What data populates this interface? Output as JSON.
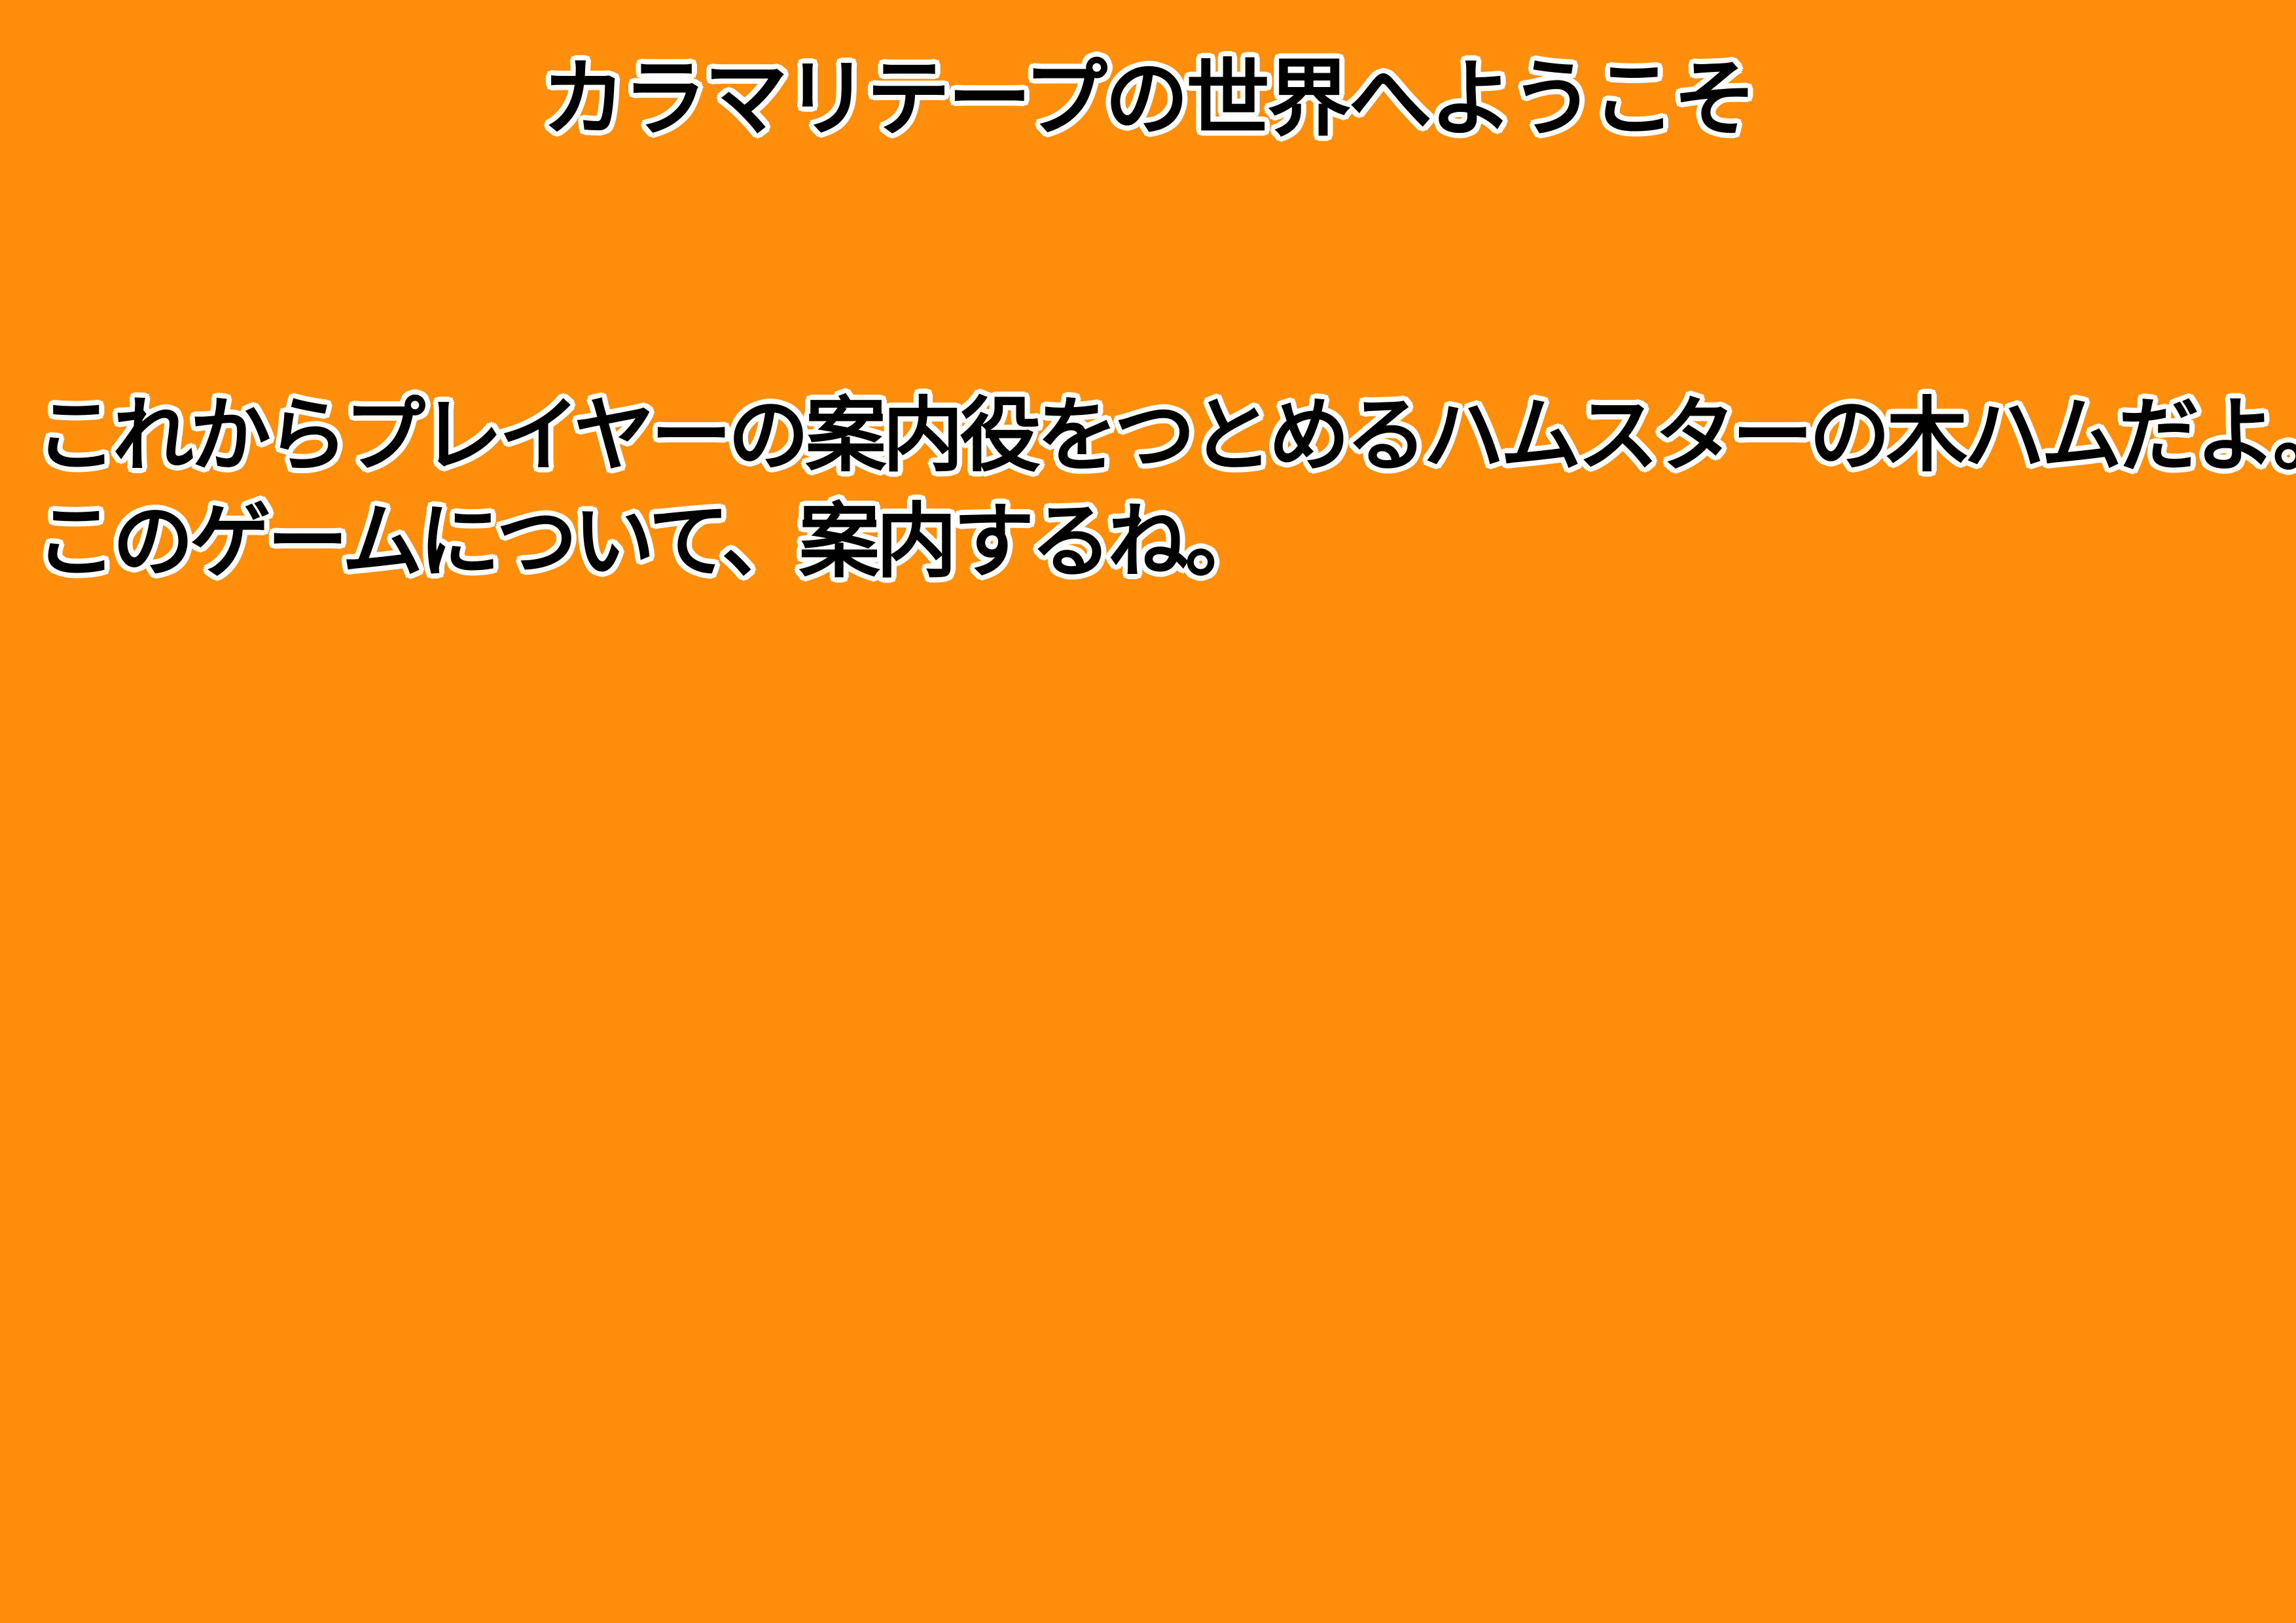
{
  "slide": {
    "title": "カラマリテープの世界へようこそ",
    "lines": [
      "これからプレイヤーの案内役をつとめるハムスターの木ハムだよ。",
      "このゲームについて、案内するね。"
    ]
  },
  "colors": {
    "background": "#ff8e0c",
    "text": "#000000",
    "outline": "#ffffff"
  }
}
